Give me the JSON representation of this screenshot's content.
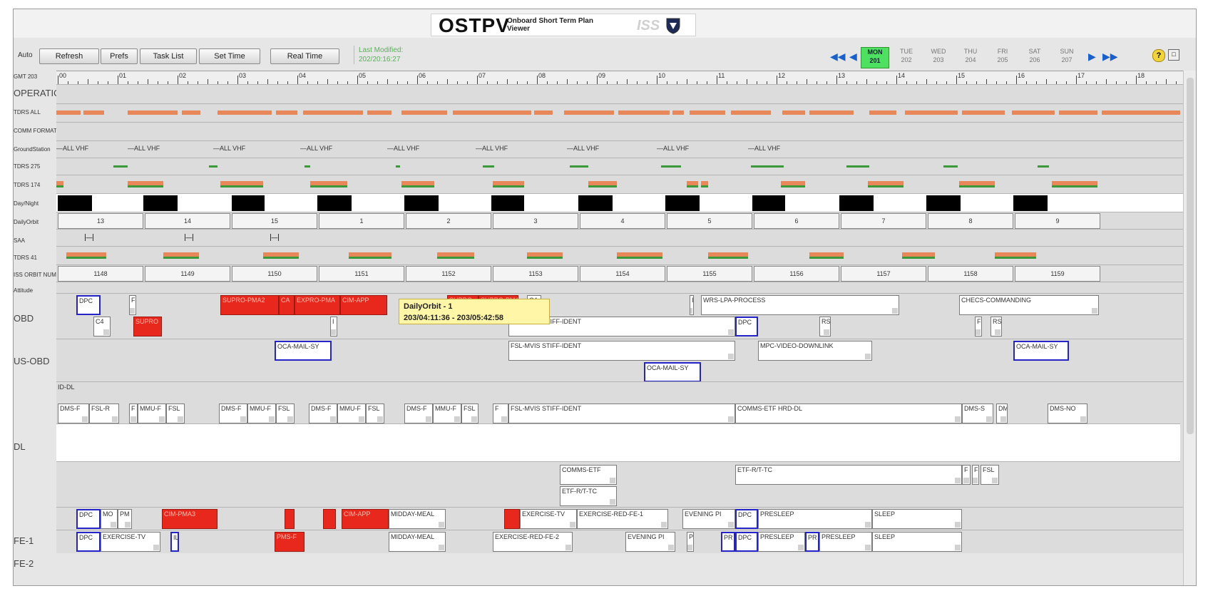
{
  "app": {
    "title": "OSTPV",
    "subtitle": "Onboard Short Term Plan Viewer",
    "logo_text": "ISS"
  },
  "toolbar": {
    "auto_label": "Auto",
    "buttons": [
      "Refresh",
      "Prefs",
      "Task List",
      "Set Time",
      "Real Time"
    ],
    "last_modified_label": "Last Modified:",
    "last_modified_value": "202/20:16:27"
  },
  "days": [
    {
      "name": "MON",
      "num": "201",
      "active": true
    },
    {
      "name": "TUE",
      "num": "202"
    },
    {
      "name": "WED",
      "num": "203"
    },
    {
      "name": "THU",
      "num": "204"
    },
    {
      "name": "FRI",
      "num": "205"
    },
    {
      "name": "SAT",
      "num": "206"
    },
    {
      "name": "SUN",
      "num": "207"
    }
  ],
  "icons": {
    "first": "double-left-arrow-icon",
    "prev": "left-arrow-icon",
    "next": "right-arrow-icon",
    "last": "double-right-arrow-icon",
    "help": "help-icon",
    "restore": "restore-icon",
    "shield": "shield-icon"
  },
  "colors": {
    "accent": "#1a60c8",
    "today": "#4ee060",
    "segment": "#e8875a",
    "green": "#3a9a3a",
    "red_activity": "#e8281c",
    "blue_border": "#2424c8",
    "tooltip": "#fff6a8"
  },
  "hour_labels": [
    "00",
    "01",
    "02",
    "03",
    "04",
    "05",
    "06",
    "07",
    "08",
    "09",
    "10",
    "11",
    "12",
    "13",
    "14",
    "15",
    "16",
    "17",
    "18"
  ],
  "row_labels": {
    "gmt": "GMT 203",
    "operations": "OPERATIONS",
    "tdrs_all": "TDRS ALL",
    "comm_format": "COMM FORMAT",
    "ground_station": "GroundStation",
    "tdrs_275": "TDRS 275",
    "tdrs_174": "TDRS 174",
    "daynight": "Day/Night",
    "daily_orbit": "DailyOrbit",
    "saa": "SAA",
    "tdrs_41": "TDRS 41",
    "iss_orbit": "ISS ORBIT NUM",
    "attitude": "Attitude",
    "obd": "OBD",
    "usobd": "US-OBD",
    "dl": "DL",
    "fe1": "FE-1",
    "fe2": "FE-2"
  },
  "vhf_labels": [
    "ALL VHF",
    "ALL VHF",
    "ALL VHF",
    "ALL VHF",
    "ALL VHF",
    "ALL VHF",
    "ALL VHF",
    "ALL VHF",
    "ALL VHF"
  ],
  "daily_orbit_values": [
    "13",
    "14",
    "15",
    "1",
    "2",
    "3",
    "4",
    "5",
    "6",
    "7",
    "8",
    "9"
  ],
  "iss_orbit_values": [
    "1148",
    "1149",
    "1150",
    "1151",
    "1152",
    "1153",
    "1154",
    "1155",
    "1156",
    "1157",
    "1158",
    "1159"
  ],
  "tooltip": {
    "title": "DailyOrbit - 1",
    "range": "203/04:11:36 - 203/05:42:58"
  },
  "activities": {
    "obd1": [
      "DPC",
      "F",
      "SUPRO-PMA2",
      "CA",
      "EXPRO-PMA",
      "CIM-APP",
      "SUPRO",
      "SUPRO-PMA",
      "C4",
      "I",
      "WRS-LPA-PROCESS",
      "CHECS-COMMANDING"
    ],
    "obd2": [
      "C4",
      "SUPRO",
      "I",
      "FSL-MVIS STIFF-IDENT",
      "DPC",
      "RS",
      "F",
      "RS"
    ],
    "usobd1": [
      "OCA-MAIL-SY",
      "FSL-MVIS STIFF-IDENT",
      "MPC-VIDEO-DOWNLINK",
      "OCA-MAIL-SY"
    ],
    "usobd2": [
      "OCA-MAIL-SY"
    ],
    "dl_top": "ID-DL",
    "dl1": [
      "DMS-F",
      "FSL-R",
      "F",
      "MMU-F",
      "FSL",
      "DMS-F",
      "MMU-F",
      "FSL",
      "DMS-F",
      "MMU-F",
      "FSL",
      "DMS-F",
      "MMU-F",
      "FSL",
      "F",
      "FSL-MVIS STIFF-IDENT",
      "COMMS-ETF HRD-DL",
      "DMS-S",
      "DM",
      "DMS-NO"
    ],
    "dl2": [
      "COMMS-ETF",
      "ETF-R/T-TC",
      "F",
      "F",
      "FSL"
    ],
    "dl3": [
      "ETF-R/T-TC"
    ],
    "fe1": [
      "DPC",
      "MO",
      "PM",
      "CIM-PMA3",
      "",
      "",
      "CIM-APP",
      "MIDDAY-MEAL",
      "",
      "EXERCISE-TV",
      "EXERCISE-RED-FE-1",
      "EVENING PI",
      "DPC",
      "PRESLEEP",
      "SLEEP"
    ],
    "fe2": [
      "DPC",
      "EXERCISE-TV",
      "IL",
      "PMS-F",
      "MIDDAY-MEAL",
      "EXERCISE-RED-FE-2",
      "EVENING PI",
      "PR",
      "PR",
      "DPC",
      "PRESLEEP",
      "PR",
      "PRESLEEP",
      "SLEEP"
    ]
  }
}
